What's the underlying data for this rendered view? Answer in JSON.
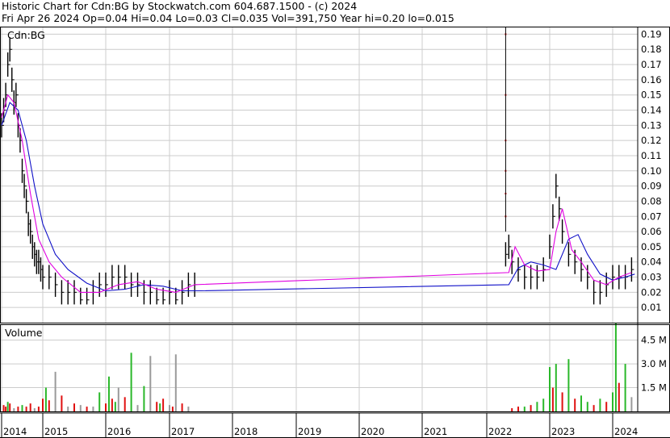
{
  "header": {
    "line1": "Historic Chart for Cdn:BG by Stockwatch.com 604.687.1500 - (c) 2024",
    "line2": "Fri Apr 26 2024   Op=0.04   Hi=0.04   Lo=0.03   Cl=0.035   Vol=391,750   Year hi=0.20   lo=0.015"
  },
  "colors": {
    "price_bar": "#000000",
    "ma_short": "#e000e0",
    "ma_long": "#1010c8",
    "vol_up": "#2ab82a",
    "vol_down": "#e01010",
    "vol_flat": "#9a9a9a",
    "grid": "#cccccc",
    "spike": "#e01010"
  },
  "chart_data": [
    {
      "type": "line",
      "title": "Cdn:BG",
      "x_ticks": [
        "2014",
        "2015",
        "2016",
        "2017",
        "2018",
        "2019",
        "2020",
        "2021",
        "2022",
        "2023",
        "2024"
      ],
      "y_ticks": [
        "0.19",
        "0.18",
        "0.17",
        "0.16",
        "0.15",
        "0.14",
        "0.13",
        "0.12",
        "0.11",
        "0.10",
        "0.09",
        "0.08",
        "0.07",
        "0.06",
        "0.05",
        "0.04",
        "0.03",
        "0.02",
        "0.01"
      ],
      "ylim": [
        0,
        0.195
      ],
      "grid": true,
      "series": [
        {
          "role": "price",
          "x": [
            2014.0,
            2014.05,
            2014.1,
            2014.15,
            2014.2,
            2014.25,
            2014.3,
            2014.35,
            2014.4,
            2014.45,
            2014.5,
            2014.55,
            2014.6,
            2014.65,
            2014.7,
            2014.75,
            2014.8,
            2014.85,
            2014.9,
            2014.95,
            2015.0,
            2015.1,
            2015.2,
            2015.3,
            2015.4,
            2015.5,
            2015.6,
            2015.7,
            2015.8,
            2015.9,
            2016.0,
            2016.1,
            2016.2,
            2016.3,
            2016.4,
            2016.5,
            2016.6,
            2016.7,
            2016.8,
            2016.9,
            2017.0,
            2017.1,
            2017.2,
            2017.3,
            2017.4,
            2022.3,
            2022.35,
            2022.4,
            2022.5,
            2022.6,
            2022.7,
            2022.8,
            2022.9,
            2023.0,
            2023.05,
            2023.1,
            2023.15,
            2023.2,
            2023.3,
            2023.4,
            2023.5,
            2023.6,
            2023.7,
            2023.8,
            2023.9,
            2024.0,
            2024.1,
            2024.2,
            2024.3
          ],
          "values": [
            0.13,
            0.14,
            0.15,
            0.17,
            0.18,
            0.16,
            0.145,
            0.15,
            0.13,
            0.12,
            0.1,
            0.09,
            0.08,
            0.065,
            0.06,
            0.05,
            0.045,
            0.04,
            0.04,
            0.035,
            0.03,
            0.03,
            0.025,
            0.02,
            0.02,
            0.02,
            0.015,
            0.015,
            0.02,
            0.025,
            0.025,
            0.03,
            0.03,
            0.03,
            0.025,
            0.025,
            0.02,
            0.02,
            0.015,
            0.015,
            0.02,
            0.015,
            0.02,
            0.025,
            0.025,
            0.045,
            0.05,
            0.04,
            0.035,
            0.03,
            0.03,
            0.03,
            0.035,
            0.05,
            0.07,
            0.09,
            0.075,
            0.06,
            0.045,
            0.04,
            0.035,
            0.03,
            0.02,
            0.02,
            0.025,
            0.03,
            0.03,
            0.03,
            0.035
          ]
        },
        {
          "role": "short-ma",
          "x": [
            2014.0,
            2014.15,
            2014.3,
            2014.5,
            2014.7,
            2014.9,
            2015.1,
            2015.3,
            2015.6,
            2015.9,
            2016.2,
            2016.5,
            2016.8,
            2017.1,
            2017.4,
            2022.35,
            2022.45,
            2022.6,
            2022.8,
            2023.0,
            2023.1,
            2023.2,
            2023.35,
            2023.5,
            2023.7,
            2023.9,
            2024.1,
            2024.3
          ],
          "values": [
            0.135,
            0.15,
            0.145,
            0.12,
            0.085,
            0.055,
            0.04,
            0.03,
            0.02,
            0.02,
            0.025,
            0.027,
            0.022,
            0.02,
            0.025,
            0.033,
            0.05,
            0.038,
            0.034,
            0.035,
            0.06,
            0.075,
            0.048,
            0.04,
            0.028,
            0.025,
            0.03,
            0.033
          ]
        },
        {
          "role": "long-ma",
          "x": [
            2014.0,
            2014.2,
            2014.4,
            2014.6,
            2014.8,
            2015.0,
            2015.2,
            2015.4,
            2015.7,
            2016.0,
            2016.3,
            2016.6,
            2016.9,
            2017.2,
            2017.5,
            2022.35,
            2022.5,
            2022.7,
            2022.9,
            2023.1,
            2023.3,
            2023.45,
            2023.6,
            2023.8,
            2024.0,
            2024.2,
            2024.35
          ],
          "values": [
            0.13,
            0.145,
            0.14,
            0.12,
            0.09,
            0.065,
            0.045,
            0.035,
            0.026,
            0.021,
            0.022,
            0.025,
            0.024,
            0.021,
            0.021,
            0.025,
            0.036,
            0.04,
            0.038,
            0.035,
            0.055,
            0.058,
            0.045,
            0.032,
            0.028,
            0.03,
            0.032
          ]
        }
      ]
    },
    {
      "type": "bar",
      "title": "Volume",
      "y_ticks": [
        "4.5 M",
        "3.0 M",
        "1.5 M"
      ],
      "ylim": [
        0,
        5.5
      ],
      "grid": true,
      "x": [
        2014.05,
        2014.1,
        2014.15,
        2014.2,
        2014.3,
        2014.4,
        2014.5,
        2014.6,
        2014.7,
        2014.8,
        2014.9,
        2015.0,
        2015.05,
        2015.1,
        2015.2,
        2015.3,
        2015.4,
        2015.5,
        2015.6,
        2015.7,
        2015.8,
        2015.9,
        2016.0,
        2016.05,
        2016.1,
        2016.15,
        2016.2,
        2016.3,
        2016.4,
        2016.5,
        2016.6,
        2016.7,
        2016.8,
        2016.85,
        2016.9,
        2017.0,
        2017.05,
        2017.1,
        2017.2,
        2017.3,
        2022.4,
        2022.5,
        2022.6,
        2022.7,
        2022.8,
        2022.9,
        2023.0,
        2023.05,
        2023.1,
        2023.2,
        2023.3,
        2023.4,
        2023.5,
        2023.6,
        2023.7,
        2023.8,
        2023.9,
        2024.0,
        2024.05,
        2024.1,
        2024.2,
        2024.3
      ],
      "values": [
        0.4,
        0.3,
        0.6,
        0.5,
        0.2,
        0.3,
        0.4,
        0.3,
        0.5,
        0.2,
        0.3,
        0.8,
        1.5,
        0.7,
        2.5,
        1.0,
        0.3,
        0.5,
        0.4,
        0.3,
        0.3,
        1.2,
        0.5,
        2.2,
        0.8,
        0.6,
        1.5,
        0.9,
        3.7,
        0.4,
        1.6,
        3.5,
        0.6,
        0.5,
        0.8,
        0.4,
        0.3,
        3.6,
        0.5,
        0.3,
        0.2,
        0.3,
        0.3,
        0.4,
        0.6,
        0.8,
        2.8,
        1.5,
        3.0,
        1.2,
        3.3,
        0.8,
        1.0,
        0.6,
        0.4,
        0.8,
        0.6,
        1.2,
        5.6,
        1.8,
        3.0,
        0.9
      ],
      "colors": [
        "down",
        "down",
        "up",
        "down",
        "flat",
        "down",
        "up",
        "down",
        "down",
        "flat",
        "down",
        "down",
        "up",
        "down",
        "flat",
        "down",
        "flat",
        "down",
        "flat",
        "down",
        "flat",
        "up",
        "down",
        "up",
        "down",
        "up",
        "flat",
        "down",
        "up",
        "flat",
        "up",
        "flat",
        "down",
        "up",
        "down",
        "flat",
        "down",
        "flat",
        "down",
        "flat",
        "down",
        "down",
        "up",
        "down",
        "up",
        "up",
        "up",
        "down",
        "up",
        "down",
        "up",
        "down",
        "up",
        "up",
        "down",
        "up",
        "down",
        "up",
        "up",
        "down",
        "up",
        "flat"
      ]
    }
  ]
}
